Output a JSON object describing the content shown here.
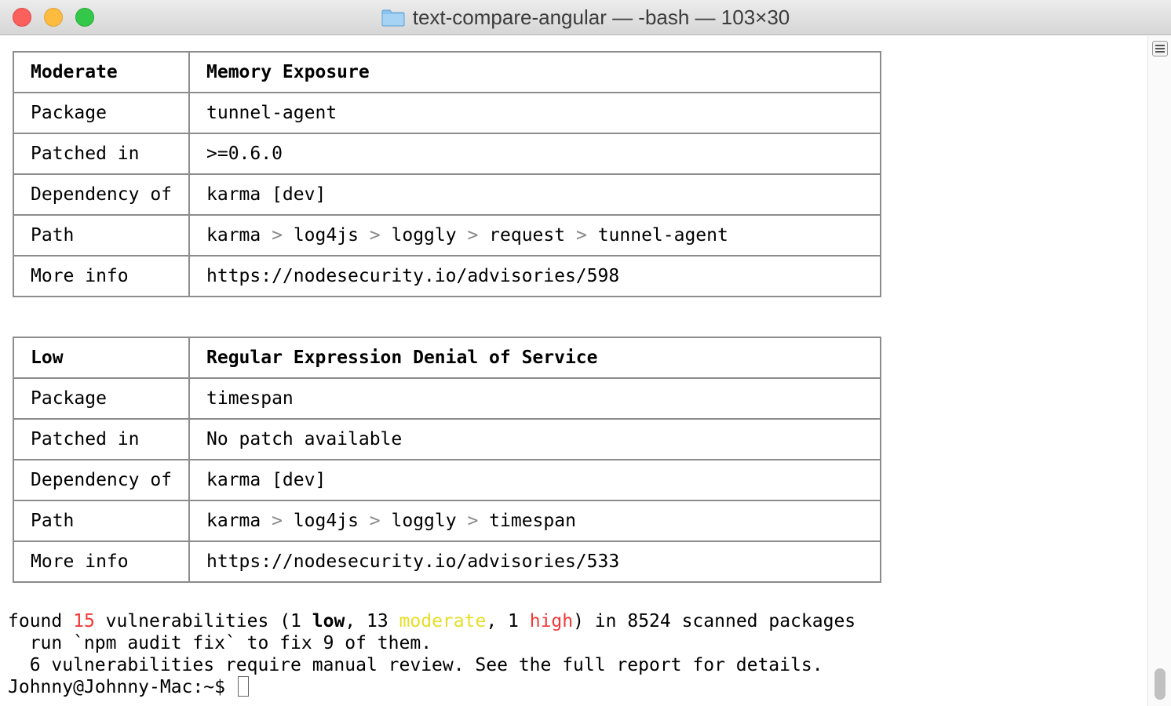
{
  "window": {
    "title": "text-compare-angular — -bash — 103×30",
    "folder_icon": "folder-icon"
  },
  "advisories": [
    {
      "severity": "Moderate",
      "title": "Memory Exposure",
      "rows": [
        {
          "label": "Package",
          "value": "tunnel-agent"
        },
        {
          "label": "Patched in",
          "value": ">=0.6.0"
        },
        {
          "label": "Dependency of",
          "value": "karma [dev]"
        },
        {
          "label": "Path",
          "path": [
            "karma",
            "log4js",
            "loggly",
            "request",
            "tunnel-agent"
          ]
        },
        {
          "label": "More info",
          "value": "https://nodesecurity.io/advisories/598"
        }
      ]
    },
    {
      "severity": "Low",
      "title": "Regular Expression Denial of Service",
      "rows": [
        {
          "label": "Package",
          "value": "timespan"
        },
        {
          "label": "Patched in",
          "value": "No patch available"
        },
        {
          "label": "Dependency of",
          "value": "karma [dev]"
        },
        {
          "label": "Path",
          "path": [
            "karma",
            "log4js",
            "loggly",
            "timespan"
          ]
        },
        {
          "label": "More info",
          "value": "https://nodesecurity.io/advisories/533"
        }
      ]
    }
  ],
  "path_separator": ">",
  "summary": {
    "found": "found ",
    "total": "15",
    "vulns": " vulnerabilities (",
    "low_count": "1 ",
    "low_word": "low",
    "sep1": ", 13 ",
    "moderate_word": "moderate",
    "sep2": ", 1 ",
    "high_word": "high",
    "tail": ") in 8524 scanned packages",
    "line2": "  run `npm audit fix` to fix 9 of them.",
    "line3": "  6 vulnerabilities require manual review. See the full report for details."
  },
  "prompt": "Johnny@Johnny-Mac:~$ ",
  "colors": {
    "moderate": "#e6de26",
    "high": "#f43838",
    "border": "#8c8c8c",
    "separator": "#888888"
  }
}
